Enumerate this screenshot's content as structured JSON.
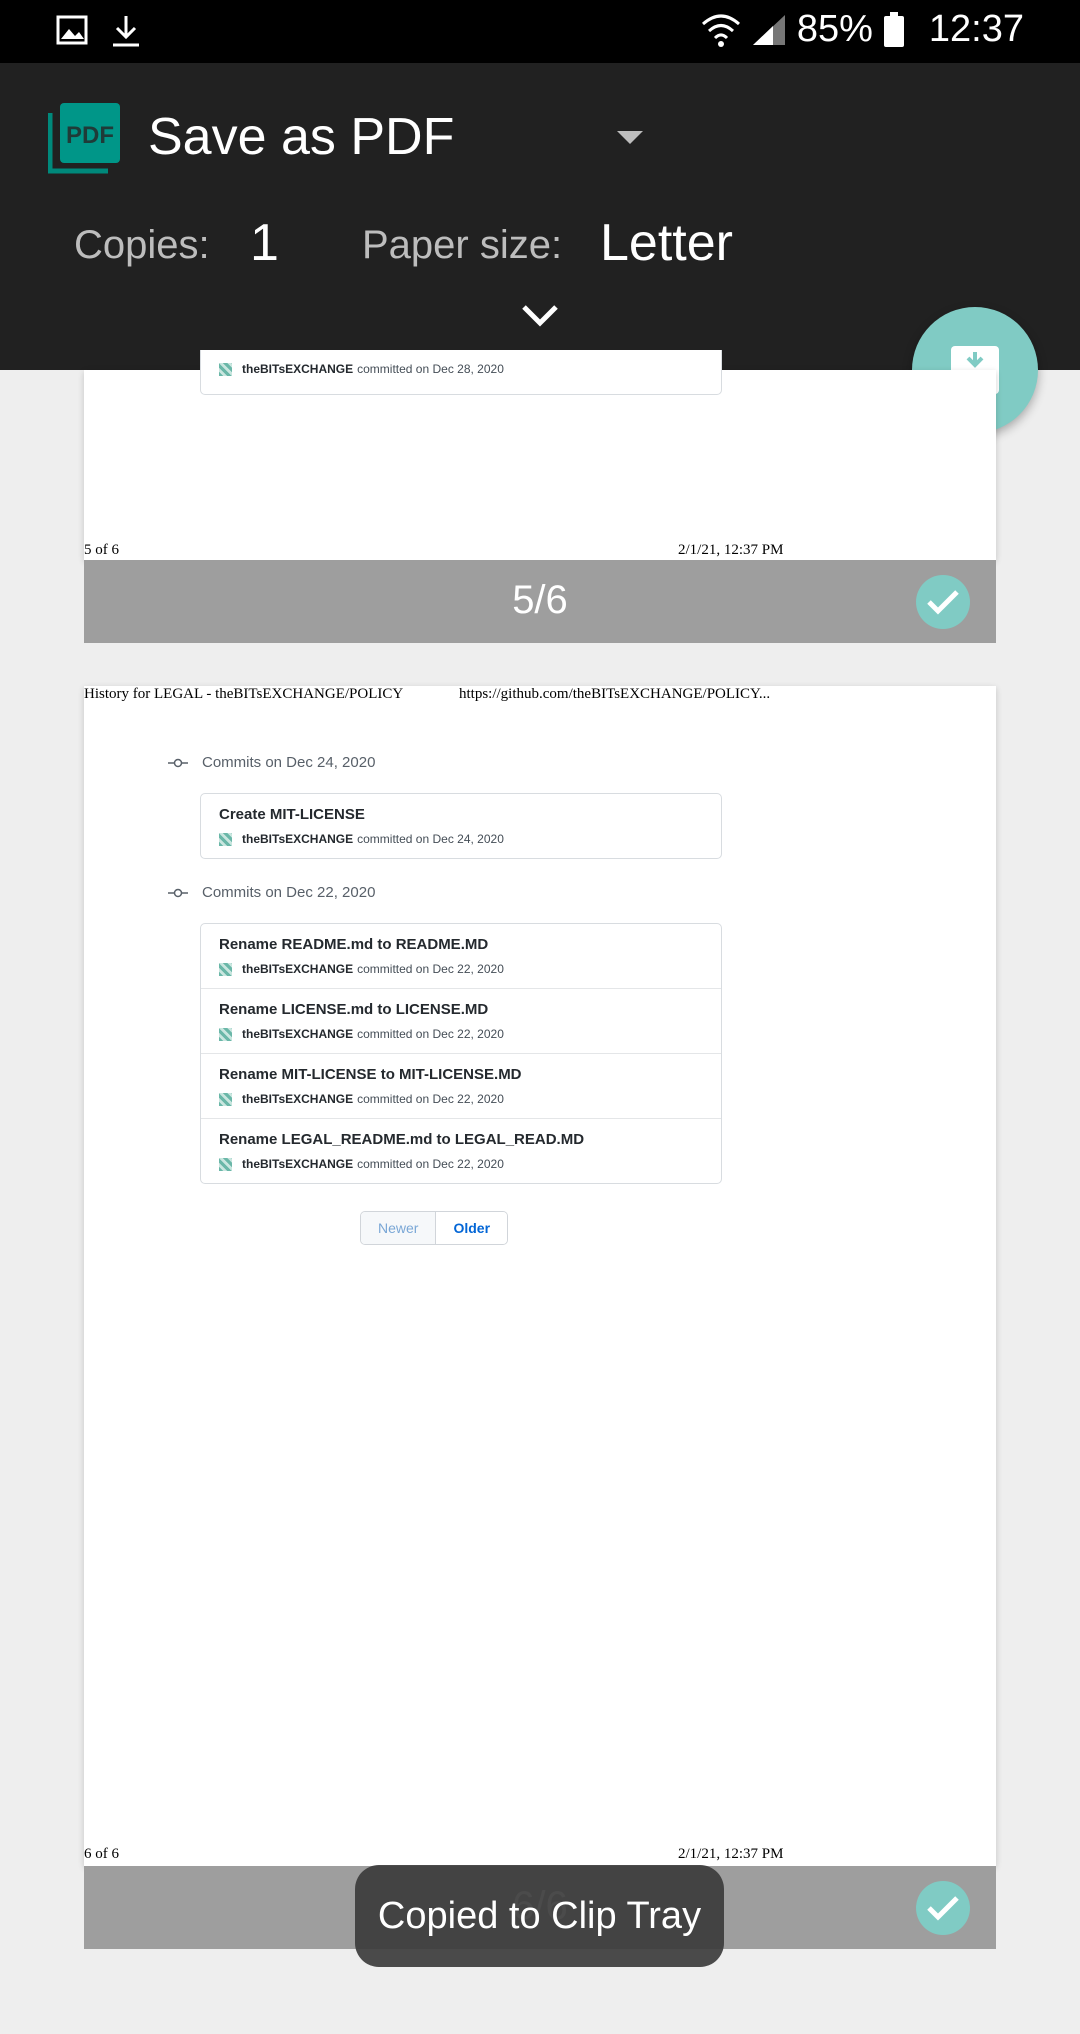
{
  "status_bar": {
    "battery": "85%",
    "time": "12:37",
    "icons": [
      "gallery-icon",
      "download-icon",
      "wifi-icon",
      "signal-icon",
      "battery-icon"
    ]
  },
  "print_header": {
    "printer_name": "Save as PDF",
    "copies_label": "Copies:",
    "copies_value": "1",
    "paper_size_label": "Paper size:",
    "paper_size_value": "Letter",
    "logo_text": "PDF",
    "fab_icon": "pdf-download-icon",
    "accent_color": "#009688"
  },
  "page5": {
    "partial_commit_author": "theBITsEXCHANGE",
    "partial_commit_text": "committed on Dec 28, 2020",
    "footer_left": "5 of 6",
    "footer_right": "2/1/21, 12:37 PM",
    "page_indicator": "5/6"
  },
  "page6": {
    "header_left": "History for LEGAL - theBITsEXCHANGE/POLICY",
    "header_right": "https://github.com/theBITsEXCHANGE/POLICY...",
    "groups": [
      {
        "heading": "Commits on Dec 24, 2020",
        "commits": [
          {
            "title": "Create MIT-LICENSE",
            "author": "theBITsEXCHANGE",
            "meta": "committed on Dec 24, 2020"
          }
        ]
      },
      {
        "heading": "Commits on Dec 22, 2020",
        "commits": [
          {
            "title": "Rename README.md to README.MD",
            "author": "theBITsEXCHANGE",
            "meta": "committed on Dec 22, 2020"
          },
          {
            "title": "Rename LICENSE.md to LICENSE.MD",
            "author": "theBITsEXCHANGE",
            "meta": "committed on Dec 22, 2020"
          },
          {
            "title": "Rename MIT-LICENSE to MIT-LICENSE.MD",
            "author": "theBITsEXCHANGE",
            "meta": "committed on Dec 22, 2020"
          },
          {
            "title": "Rename LEGAL_README.md to LEGAL_READ.MD",
            "author": "theBITsEXCHANGE",
            "meta": "committed on Dec 22, 2020"
          }
        ]
      }
    ],
    "pager_newer": "Newer",
    "pager_older": "Older",
    "footer_left": "6 of 6",
    "footer_right": "2/1/21, 12:37 PM",
    "page_indicator": "6/6"
  },
  "toast": "Copied to Clip Tray"
}
